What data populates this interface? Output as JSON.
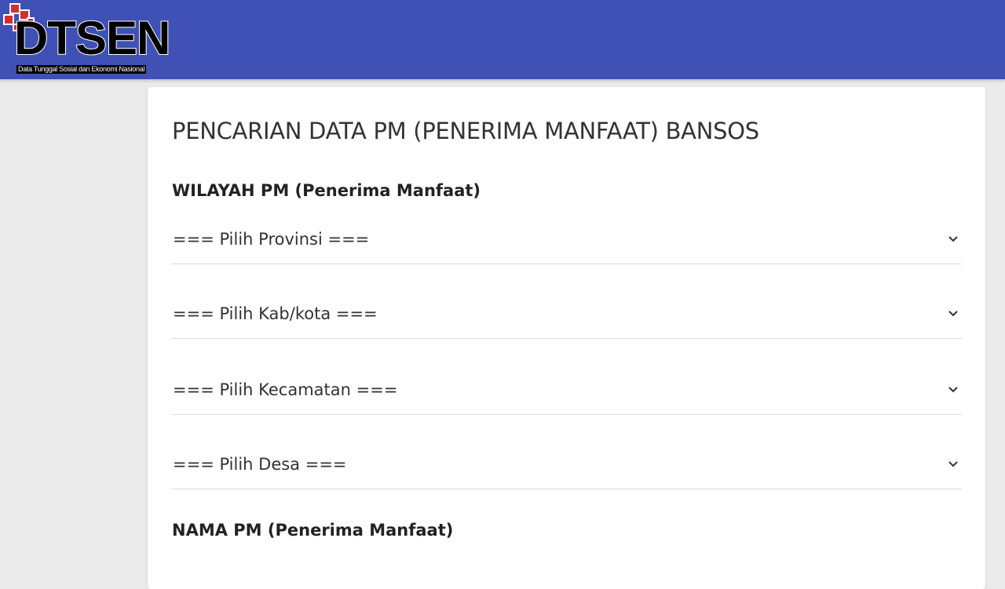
{
  "header": {
    "logo_text": "DTSEN",
    "logo_tagline": "Data Tunggal Sosial dan Ekonomi Nasional",
    "background_color": "#3f51b5",
    "logo_accent_color": "#d32f2f"
  },
  "form": {
    "title": "PENCARIAN DATA PM (PENERIMA MANFAAT) BANSOS",
    "wilayah_section_title": "WILAYAH PM (Penerima Manfaat)",
    "selects": [
      {
        "label": "=== Pilih Provinsi ===",
        "icon": "chevron-down-icon"
      },
      {
        "label": "=== Pilih Kab/kota ===",
        "icon": "chevron-down-icon"
      },
      {
        "label": "=== Pilih Kecamatan ===",
        "icon": "chevron-down-icon"
      },
      {
        "label": "=== Pilih Desa ===",
        "icon": "chevron-down-icon"
      }
    ],
    "nama_section_title": "NAMA PM (Penerima Manfaat)"
  }
}
